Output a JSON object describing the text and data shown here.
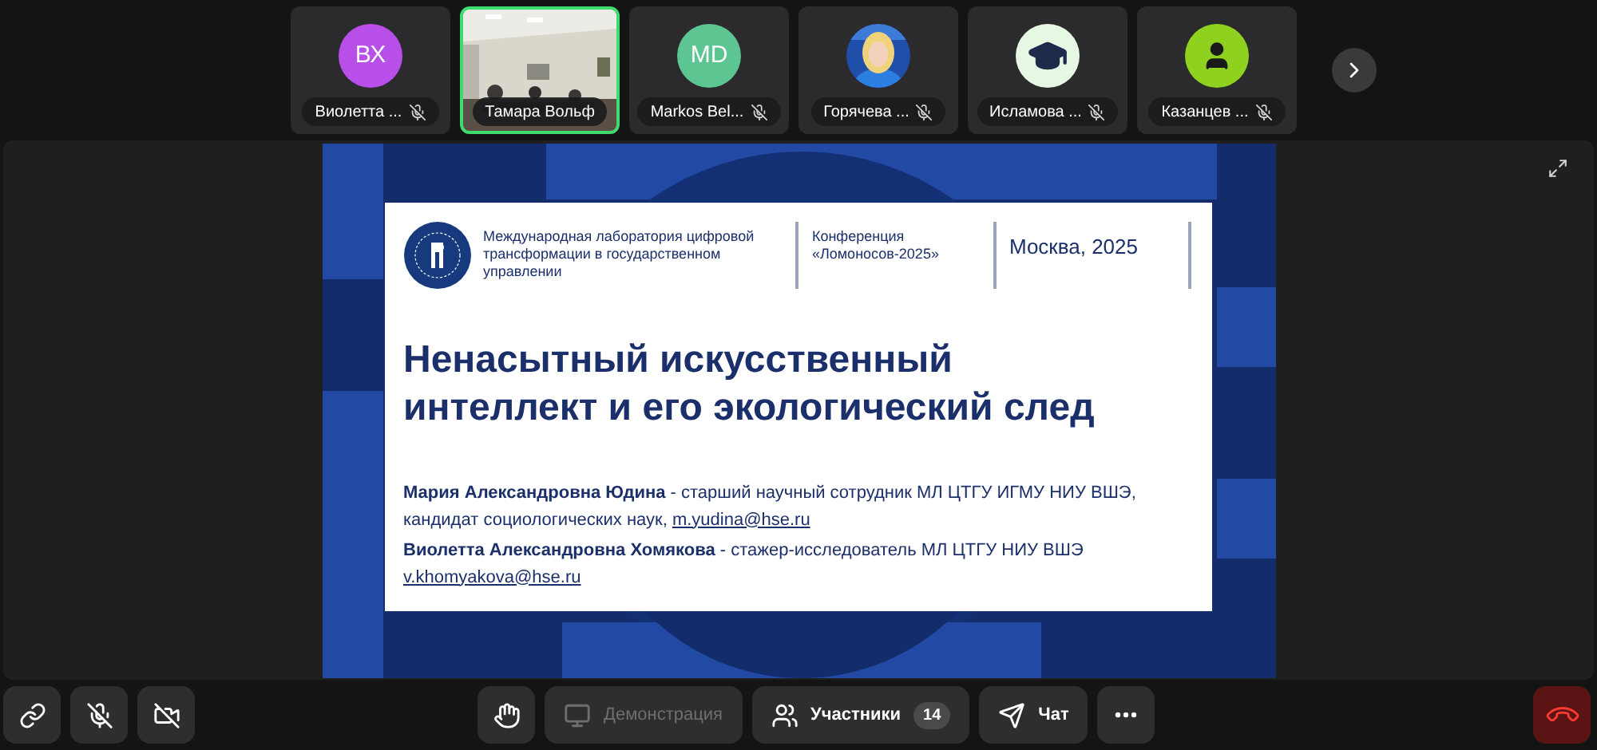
{
  "participants": [
    {
      "name": "Виолетта ...",
      "kind": "initials",
      "initials": "ВХ",
      "color": "#b84fe8",
      "muted": true,
      "selected": false
    },
    {
      "name": "Тамара Вольф",
      "kind": "video",
      "muted": false,
      "selected": true
    },
    {
      "name": "Markos Bel...",
      "kind": "initials",
      "initials": "MD",
      "color": "#5cc592",
      "muted": true,
      "selected": false
    },
    {
      "name": "Горячева ...",
      "muted": true,
      "selected": false
    },
    {
      "name": "Исламова ...",
      "kind": "cap",
      "color": "#e6f7e3",
      "muted": true,
      "selected": false
    },
    {
      "name": "Казанцев ...",
      "kind": "person",
      "color": "#8fd11f",
      "muted": true,
      "selected": false
    }
  ],
  "slide": {
    "org": "Международная лаборатория цифровой трансформации в государственном управлении",
    "conference": "Конференция «Ломоносов-2025»",
    "place": "Москва, 2025",
    "title": "Ненасытный искусственный интеллект и его экологический след",
    "authors": [
      {
        "text": "**Мария Александровна Юдина** - старший научный сотрудник МЛ ЦТГУ ИГМУ НИУ ВШЭ, кандидат социологических наук,",
        "email": "m.yudina@hse.ru"
      },
      {
        "text": "**Виолетта Александровна Хомякова** - стажер-исследователь МЛ ЦТГУ НИУ ВШЭ",
        "email": "v.khomyakova@hse.ru"
      }
    ]
  },
  "toolbar": {
    "left": [
      {
        "kind": "link"
      },
      {
        "kind": "mic-off"
      },
      {
        "kind": "camera-off"
      }
    ],
    "center": [
      {
        "kind": "hand"
      },
      {
        "kind": "share",
        "label": "Демонстрация",
        "disabled": true
      },
      {
        "kind": "participants",
        "label": "Участники",
        "count": "14",
        "disabled": false
      },
      {
        "kind": "chat",
        "label": "Чат",
        "disabled": false
      },
      {
        "kind": "more"
      }
    ],
    "right": [
      {
        "kind": "end-call"
      }
    ]
  }
}
